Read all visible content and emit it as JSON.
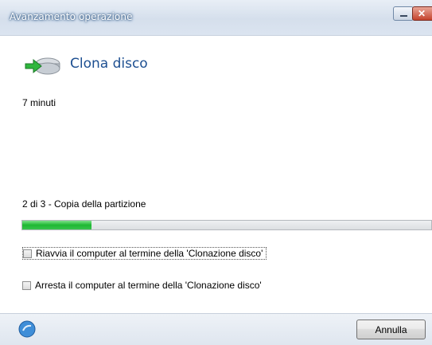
{
  "window": {
    "title": "Avanzamento operazione"
  },
  "header": {
    "title": "Clona disco",
    "icon": "clone-disk-icon"
  },
  "status": {
    "time_remaining": "7 minuti",
    "step": "2 di 3 - Copia della partizione",
    "progress": 0.17
  },
  "options": {
    "restart_label": "Riavvia il computer al termine della 'Clonazione disco'",
    "shutdown_label": "Arresta il computer al termine della 'Clonazione disco'",
    "restart_checked": false,
    "shutdown_checked": false
  },
  "footer": {
    "cancel_label": "Annulla",
    "help_icon": "help-icon"
  },
  "colors": {
    "heading": "#1d4f91",
    "progress": "#1db832"
  }
}
